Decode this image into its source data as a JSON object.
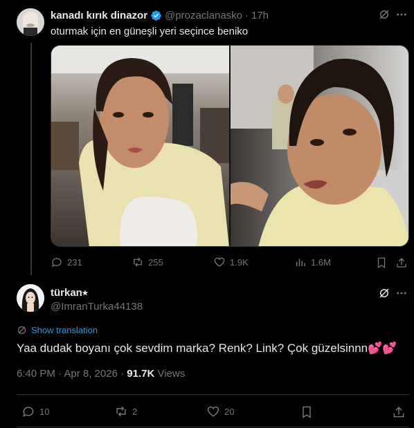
{
  "original_tweet": {
    "display_name": "kanadı kırık dinazor",
    "handle": "@prozaclanasko",
    "separator": "·",
    "time": "17h",
    "text": "oturmak için en güneşli yeri seçince beniko",
    "stats": {
      "replies": "231",
      "reposts": "255",
      "likes": "1.9K",
      "views": "1.6M"
    }
  },
  "reply_tweet": {
    "display_name": "türkan⭒",
    "handle": "@ImranTurka44138",
    "show_translation_label": "Show translation",
    "text": "Yaa dudak boyanı çok sevdim marka? Renk? Link? Çok güzelsinnn💕💕",
    "date": "6:40 PM · Apr 8, 2026 · ",
    "views_count": "91.7K",
    "views_label": " Views",
    "stats": {
      "replies": "10",
      "reposts": "2",
      "likes": "20"
    }
  },
  "icons": [
    "grok-icon",
    "more-icon",
    "verified-icon",
    "reply-icon",
    "repost-icon",
    "like-icon",
    "views-icon",
    "bookmark-icon",
    "share-icon",
    "globe-icon"
  ],
  "colors": {
    "background": "#000000",
    "text": "#e7e9ea",
    "secondary": "#71767b",
    "accent": "#1d9bf0",
    "divider": "#2f3336"
  }
}
